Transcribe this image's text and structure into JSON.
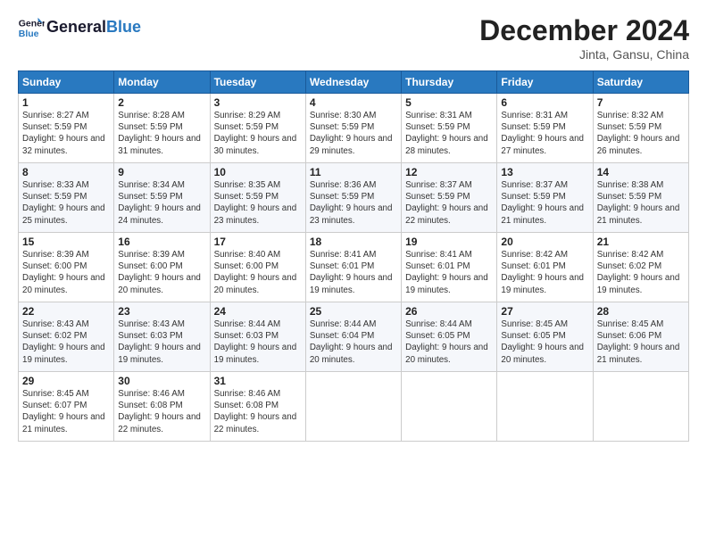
{
  "header": {
    "logo_line1": "General",
    "logo_line2": "Blue",
    "month_title": "December 2024",
    "location": "Jinta, Gansu, China"
  },
  "columns": [
    "Sunday",
    "Monday",
    "Tuesday",
    "Wednesday",
    "Thursday",
    "Friday",
    "Saturday"
  ],
  "weeks": [
    [
      {
        "day": "1",
        "sunrise": "8:27 AM",
        "sunset": "5:59 PM",
        "daylight": "9 hours and 32 minutes."
      },
      {
        "day": "2",
        "sunrise": "8:28 AM",
        "sunset": "5:59 PM",
        "daylight": "9 hours and 31 minutes."
      },
      {
        "day": "3",
        "sunrise": "8:29 AM",
        "sunset": "5:59 PM",
        "daylight": "9 hours and 30 minutes."
      },
      {
        "day": "4",
        "sunrise": "8:30 AM",
        "sunset": "5:59 PM",
        "daylight": "9 hours and 29 minutes."
      },
      {
        "day": "5",
        "sunrise": "8:31 AM",
        "sunset": "5:59 PM",
        "daylight": "9 hours and 28 minutes."
      },
      {
        "day": "6",
        "sunrise": "8:31 AM",
        "sunset": "5:59 PM",
        "daylight": "9 hours and 27 minutes."
      },
      {
        "day": "7",
        "sunrise": "8:32 AM",
        "sunset": "5:59 PM",
        "daylight": "9 hours and 26 minutes."
      }
    ],
    [
      {
        "day": "8",
        "sunrise": "8:33 AM",
        "sunset": "5:59 PM",
        "daylight": "9 hours and 25 minutes."
      },
      {
        "day": "9",
        "sunrise": "8:34 AM",
        "sunset": "5:59 PM",
        "daylight": "9 hours and 24 minutes."
      },
      {
        "day": "10",
        "sunrise": "8:35 AM",
        "sunset": "5:59 PM",
        "daylight": "9 hours and 23 minutes."
      },
      {
        "day": "11",
        "sunrise": "8:36 AM",
        "sunset": "5:59 PM",
        "daylight": "9 hours and 23 minutes."
      },
      {
        "day": "12",
        "sunrise": "8:37 AM",
        "sunset": "5:59 PM",
        "daylight": "9 hours and 22 minutes."
      },
      {
        "day": "13",
        "sunrise": "8:37 AM",
        "sunset": "5:59 PM",
        "daylight": "9 hours and 21 minutes."
      },
      {
        "day": "14",
        "sunrise": "8:38 AM",
        "sunset": "5:59 PM",
        "daylight": "9 hours and 21 minutes."
      }
    ],
    [
      {
        "day": "15",
        "sunrise": "8:39 AM",
        "sunset": "6:00 PM",
        "daylight": "9 hours and 20 minutes."
      },
      {
        "day": "16",
        "sunrise": "8:39 AM",
        "sunset": "6:00 PM",
        "daylight": "9 hours and 20 minutes."
      },
      {
        "day": "17",
        "sunrise": "8:40 AM",
        "sunset": "6:00 PM",
        "daylight": "9 hours and 20 minutes."
      },
      {
        "day": "18",
        "sunrise": "8:41 AM",
        "sunset": "6:01 PM",
        "daylight": "9 hours and 19 minutes."
      },
      {
        "day": "19",
        "sunrise": "8:41 AM",
        "sunset": "6:01 PM",
        "daylight": "9 hours and 19 minutes."
      },
      {
        "day": "20",
        "sunrise": "8:42 AM",
        "sunset": "6:01 PM",
        "daylight": "9 hours and 19 minutes."
      },
      {
        "day": "21",
        "sunrise": "8:42 AM",
        "sunset": "6:02 PM",
        "daylight": "9 hours and 19 minutes."
      }
    ],
    [
      {
        "day": "22",
        "sunrise": "8:43 AM",
        "sunset": "6:02 PM",
        "daylight": "9 hours and 19 minutes."
      },
      {
        "day": "23",
        "sunrise": "8:43 AM",
        "sunset": "6:03 PM",
        "daylight": "9 hours and 19 minutes."
      },
      {
        "day": "24",
        "sunrise": "8:44 AM",
        "sunset": "6:03 PM",
        "daylight": "9 hours and 19 minutes."
      },
      {
        "day": "25",
        "sunrise": "8:44 AM",
        "sunset": "6:04 PM",
        "daylight": "9 hours and 20 minutes."
      },
      {
        "day": "26",
        "sunrise": "8:44 AM",
        "sunset": "6:05 PM",
        "daylight": "9 hours and 20 minutes."
      },
      {
        "day": "27",
        "sunrise": "8:45 AM",
        "sunset": "6:05 PM",
        "daylight": "9 hours and 20 minutes."
      },
      {
        "day": "28",
        "sunrise": "8:45 AM",
        "sunset": "6:06 PM",
        "daylight": "9 hours and 21 minutes."
      }
    ],
    [
      {
        "day": "29",
        "sunrise": "8:45 AM",
        "sunset": "6:07 PM",
        "daylight": "9 hours and 21 minutes."
      },
      {
        "day": "30",
        "sunrise": "8:46 AM",
        "sunset": "6:08 PM",
        "daylight": "9 hours and 22 minutes."
      },
      {
        "day": "31",
        "sunrise": "8:46 AM",
        "sunset": "6:08 PM",
        "daylight": "9 hours and 22 minutes."
      },
      null,
      null,
      null,
      null
    ]
  ],
  "labels": {
    "sunrise": "Sunrise:",
    "sunset": "Sunset:",
    "daylight": "Daylight:"
  }
}
